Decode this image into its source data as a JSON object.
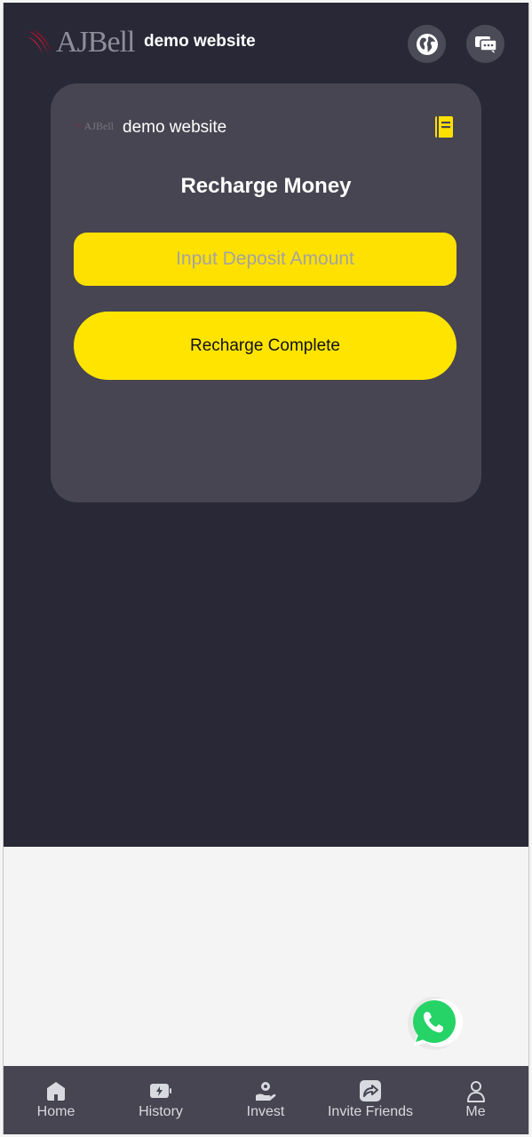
{
  "header": {
    "logo_text": "AJBell",
    "site_name": "demo website"
  },
  "card": {
    "logo_text": "AJBell",
    "site_name": "demo website",
    "title": "Recharge Money",
    "amount_placeholder": "Input Deposit Amount",
    "amount_value": "",
    "recharge_label": "Recharge Complete"
  },
  "tabbar": {
    "items": [
      {
        "label": "Home",
        "icon": "home-icon"
      },
      {
        "label": "History",
        "icon": "battery-bolt-icon"
      },
      {
        "label": "Invest",
        "icon": "invest-hand-icon"
      },
      {
        "label": "Invite Friends",
        "icon": "share-icon"
      },
      {
        "label": "Me",
        "icon": "person-icon"
      }
    ]
  },
  "colors": {
    "background_dark": "#292837",
    "card": "#464551",
    "accent_yellow": "#ffe100",
    "logo_red": "#c0142c",
    "whatsapp_green": "#25d366"
  }
}
